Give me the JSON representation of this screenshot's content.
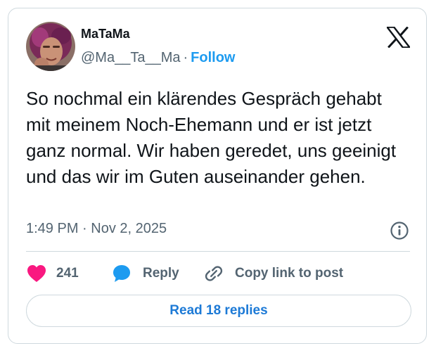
{
  "author": {
    "display_name": "MaTaMa",
    "handle": "@Ma__Ta__Ma",
    "separator": "·",
    "follow_label": "Follow"
  },
  "tweet": {
    "text": "So nochmal ein klärendes Gespräch gehabt mit meinem Noch-Ehemann und er ist jetzt ganz normal. Wir haben geredet, uns geeinigt und das wir im Guten auseinander gehen.",
    "timestamp": "1:49 PM · Nov 2, 2025"
  },
  "actions": {
    "like_count": "241",
    "reply_label": "Reply",
    "copy_link_label": "Copy link to post"
  },
  "footer": {
    "read_replies_label": "Read 18 replies"
  },
  "icons": {
    "logo": "x-logo-icon",
    "info": "info-icon",
    "like": "heart-icon",
    "reply": "speech-bubble-icon",
    "copy": "link-icon"
  },
  "colors": {
    "like": "#f91880",
    "reply": "#1d9bf0",
    "follow": "#1d9bf0",
    "read_replies": "#1d7ad6",
    "secondary_text": "#536471"
  }
}
